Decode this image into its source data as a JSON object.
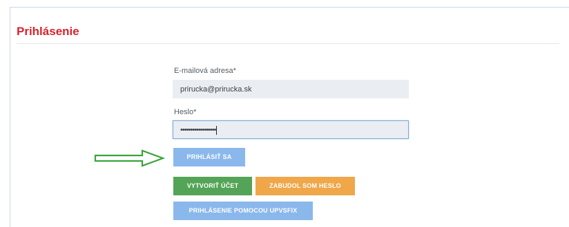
{
  "login": {
    "title": "Prihlásenie",
    "email_label": "E-mailová adresa*",
    "email_value": "prirucka@prirucka.sk",
    "password_label": "Heslo*",
    "password_value": "••••••••••••••••••"
  },
  "buttons": {
    "login": "PRIHLÁSIŤ SA",
    "create_account": "VYTVORIŤ ÚČET",
    "forgot_password": "ZABUDOL SOM HESLO",
    "upvs_login": "PRIHLÁSENIE POMOCOU UPVSFIX"
  },
  "colors": {
    "title": "#d9232e",
    "login_button": "#8ab8ec",
    "create_button": "#54a457",
    "forgot_button": "#efa74a",
    "arrow": "#3aa33a"
  },
  "icons": {
    "pointer": "green-outline-right-arrow"
  }
}
